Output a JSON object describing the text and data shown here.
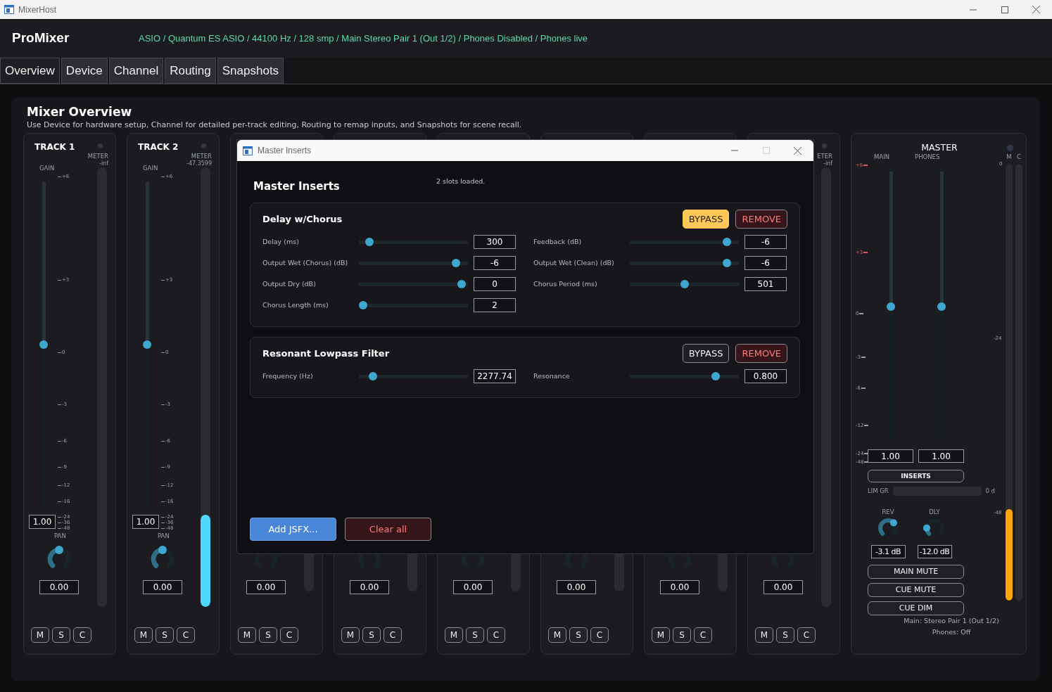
{
  "window": {
    "title": "MixerHost"
  },
  "header": {
    "app_name": "ProMixer",
    "status": "ASIO / Quantum ES ASIO / 44100 Hz / 128 smp / Main Stereo Pair 1 (Out 1/2) / Phones Disabled / Phones live"
  },
  "tabs": [
    {
      "label": "Overview",
      "selected": true
    },
    {
      "label": "Device",
      "selected": false
    },
    {
      "label": "Channel",
      "selected": false
    },
    {
      "label": "Routing",
      "selected": false
    },
    {
      "label": "Snapshots",
      "selected": false
    }
  ],
  "overview": {
    "title": "Mixer Overview",
    "description": "Use Device for hardware setup, Channel for detailed per-track editing, Routing to remap inputs, and Snapshots for scene recall."
  },
  "strips": [
    {
      "name": "TRACK 1",
      "meter_label": "METER",
      "meter_reading": "-inf",
      "gain_label": "GAIN",
      "scale": [
        "+6",
        "+3",
        "0",
        "-3",
        "-6",
        "-9",
        "-12",
        "-16",
        "-24",
        "-36",
        "-48"
      ],
      "fader": {
        "level": 0.5
      },
      "gain": "1.00",
      "pan_label": "PAN",
      "pan_knob": {
        "level": 0.5
      },
      "pan_value": "0.00",
      "meter": {
        "level": 0
      },
      "buttons": [
        "M",
        "S",
        "C"
      ]
    },
    {
      "name": "TRACK 2",
      "meter_label": "METER",
      "meter_reading": "-47.3599",
      "gain_label": "GAIN",
      "scale": [
        "+6",
        "+3",
        "0",
        "-3",
        "-6",
        "-9",
        "-12",
        "-16",
        "-24",
        "-36",
        "-48"
      ],
      "fader": {
        "level": 0.5
      },
      "gain": "1.00",
      "pan_label": "PAN",
      "pan_knob": {
        "level": 0.5
      },
      "pan_value": "0.00",
      "meter": {
        "level": 0.21
      },
      "buttons": [
        "M",
        "S",
        "C"
      ]
    },
    {
      "pan_value": "0.00",
      "meter": {
        "level": 0
      },
      "buttons": [
        "M",
        "S",
        "C"
      ]
    },
    {
      "pan_value": "0.00",
      "meter": {
        "level": 0
      },
      "buttons": [
        "M",
        "S",
        "C"
      ]
    },
    {
      "pan_value": "0.00",
      "meter": {
        "level": 0
      },
      "buttons": [
        "M",
        "S",
        "C"
      ]
    },
    {
      "pan_value": "0.00",
      "meter": {
        "level": 0
      },
      "buttons": [
        "M",
        "S",
        "C"
      ]
    },
    {
      "pan_value": "0.00",
      "meter": {
        "level": 0
      },
      "buttons": [
        "M",
        "S",
        "C"
      ]
    },
    {
      "meter_label": "ETER",
      "meter_reading": "-inf",
      "pan_value": "0.00",
      "meter": {
        "level": 0
      },
      "buttons": [
        "M",
        "S",
        "C"
      ]
    }
  ],
  "master": {
    "title": "MASTER",
    "fader_labels": [
      "MAIN",
      "PHONES"
    ],
    "scale": [
      {
        "label": "+6",
        "color": "#e05b5b"
      },
      {
        "label": "+3",
        "color": "#e05b5b"
      },
      {
        "label": "0",
        "color": "#9aa0aa"
      },
      {
        "label": "-3",
        "color": "#9aa0aa"
      },
      {
        "label": "-6",
        "color": "#9aa0aa"
      },
      {
        "label": "-12",
        "color": "#9aa0aa"
      },
      {
        "label": "-24",
        "color": "#9aa0aa"
      },
      {
        "label": "-48",
        "color": "#9aa0aa"
      }
    ],
    "faders": [
      {
        "level": 0.5,
        "value": "1.00"
      },
      {
        "level": 0.5,
        "value": "1.00"
      }
    ],
    "meters": [
      {
        "label": "M",
        "level": 0.21
      },
      {
        "label": "C",
        "level": 0
      }
    ],
    "meter_scale": [
      "0",
      "-24",
      "-48"
    ],
    "inserts_button": "INSERTS",
    "limiter": {
      "label": "LIM GR",
      "level": 0,
      "reading": "0 d"
    },
    "sends": [
      {
        "label": "REV",
        "level": 0.67,
        "value": "-3.1 dB"
      },
      {
        "label": "DLY",
        "level": 0.17,
        "value": "-12.0 dB"
      }
    ],
    "buttons": [
      "MAIN MUTE",
      "CUE MUTE",
      "CUE DIM"
    ],
    "info": [
      "Main: Stereo Pair 1 (Out 1/2)",
      "Phones: Off"
    ]
  },
  "dialog": {
    "title": "Master Inserts",
    "heading": "Master Inserts",
    "status": "2 slots loaded.",
    "inserts": [
      {
        "name": "Delay w/Chorus",
        "bypassed": true,
        "bypass_label": "BYPASS",
        "remove_label": "REMOVE",
        "params": [
          {
            "label": "Delay (ms)",
            "level": 0.06,
            "value": "300"
          },
          {
            "label": "Feedback (dB)",
            "level": 0.92,
            "value": "-6"
          },
          {
            "label": "Output Wet (Chorus) (dB)",
            "level": 0.92,
            "value": "-6"
          },
          {
            "label": "Output Wet (Clean) (dB)",
            "level": 0.92,
            "value": "-6"
          },
          {
            "label": "Output Dry (dB)",
            "level": 0.98,
            "value": "0"
          },
          {
            "label": "Chorus Period (ms)",
            "level": 0.5,
            "value": "501"
          },
          {
            "label": "Chorus Length (ms)",
            "level": 0,
            "value": "2"
          }
        ]
      },
      {
        "name": "Resonant Lowpass Filter",
        "bypassed": false,
        "bypass_label": "BYPASS",
        "remove_label": "REMOVE",
        "params": [
          {
            "label": "Frequency (Hz)",
            "level": 0.1,
            "value": "2277.74"
          },
          {
            "label": "Resonance",
            "level": 0.81,
            "value": "0.800"
          }
        ]
      }
    ],
    "add_button": "Add JSFX...",
    "clear_button": "Clear all"
  }
}
